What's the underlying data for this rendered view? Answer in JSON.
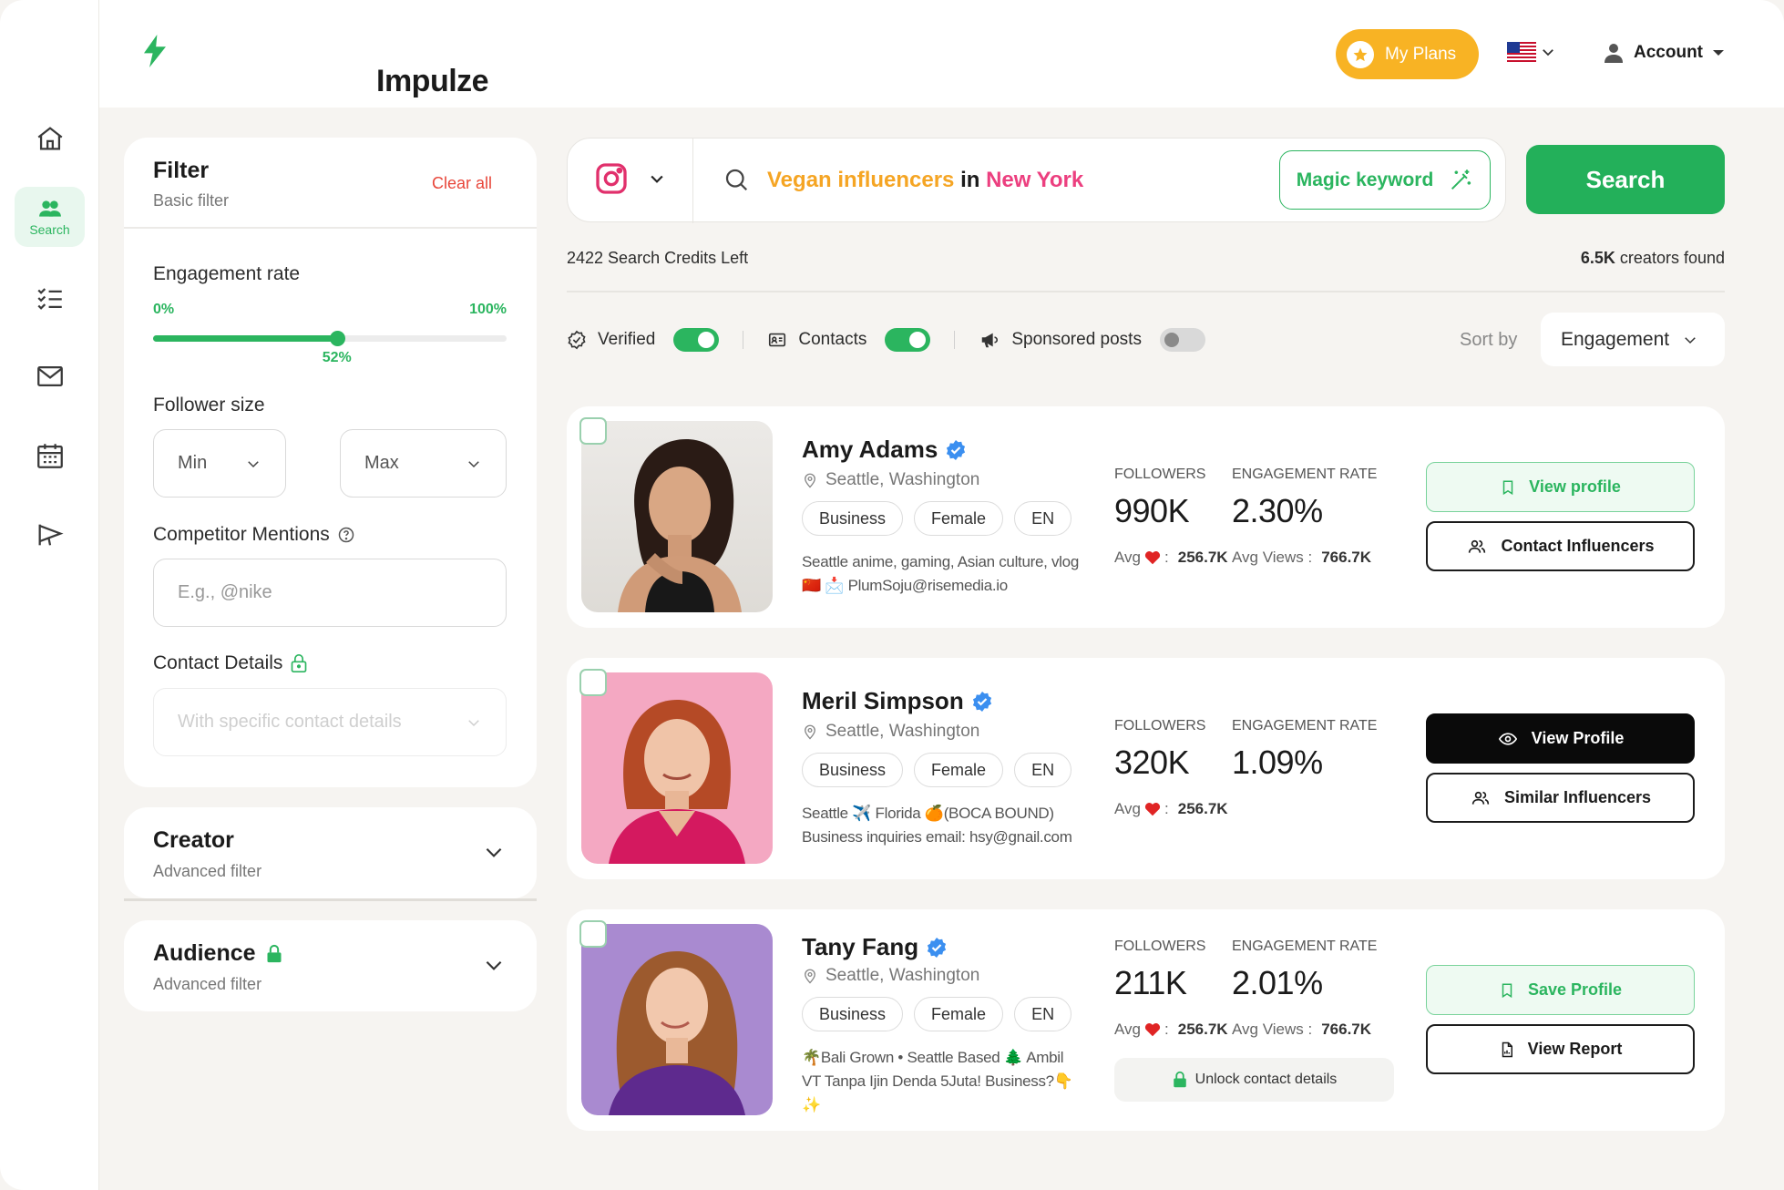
{
  "app": {
    "name": "Impulze"
  },
  "header": {
    "plans_label": "My Plans",
    "account_label": "Account"
  },
  "sidebar": {
    "items": [
      {
        "id": "home",
        "label": ""
      },
      {
        "id": "search",
        "label": "Search"
      },
      {
        "id": "lists",
        "label": ""
      },
      {
        "id": "mail",
        "label": ""
      },
      {
        "id": "calendar",
        "label": ""
      },
      {
        "id": "campaigns",
        "label": ""
      }
    ]
  },
  "filter": {
    "title": "Filter",
    "subtitle": "Basic filter",
    "clear_all": "Clear all",
    "engagement": {
      "label": "Engagement rate",
      "min_label": "0%",
      "max_label": "100%",
      "value": 52,
      "value_label": "52%"
    },
    "follower_size": {
      "label": "Follower size",
      "min": "Min",
      "max": "Max"
    },
    "competitor": {
      "label": "Competitor Mentions",
      "placeholder": "E.g., @nike"
    },
    "contact": {
      "label": "Contact Details",
      "placeholder": "With specific contact details"
    }
  },
  "accordions": [
    {
      "title": "Creator",
      "subtitle": "Advanced filter"
    },
    {
      "title": "Audience",
      "subtitle": "Advanced filter"
    }
  ],
  "search": {
    "query_part1": "Vegan influencers",
    "query_part2": " in ",
    "query_part3": "New York",
    "magic_label": "Magic keyword",
    "button_label": "Search",
    "credits": "2422 Search Credits Left",
    "found_count": "6.5K",
    "found_suffix": " creators found"
  },
  "toggles": {
    "verified": "Verified",
    "contacts": "Contacts",
    "sponsored": "Sponsored posts",
    "sort_label": "Sort by",
    "sort_value": "Engagement"
  },
  "influencers": [
    {
      "name": "Amy Adams",
      "location": "Seattle, Washington",
      "tags": [
        "Business",
        "Female",
        "EN"
      ],
      "bio": "Seattle anime, gaming, Asian culture, vlog🇨🇳 📩 PlumSoju@risemedia.io",
      "followers_label": "FOLLOWERS",
      "followers": "990K",
      "er_label": "ENGAGEMENT RATE",
      "er": "2.30%",
      "avg_label": "Avg",
      "avg_likes": "256.7K",
      "avg_views_label": "Avg Views :",
      "avg_views": "766.7K",
      "btn1": "View profile",
      "btn2": "Contact Influencers"
    },
    {
      "name": "Meril Simpson",
      "location": "Seattle, Washington",
      "tags": [
        "Business",
        "Female",
        "EN"
      ],
      "bio": "Seattle ✈️ Florida 🍊(BOCA BOUND) Business inquiries email: hsy@gnail.com",
      "followers_label": "FOLLOWERS",
      "followers": "320K",
      "er_label": "ENGAGEMENT RATE",
      "er": "1.09%",
      "avg_label": "Avg",
      "avg_likes": "256.7K",
      "btn1": "View Profile",
      "btn2": "Similar Influencers"
    },
    {
      "name": "Tany Fang",
      "location": "Seattle, Washington",
      "tags": [
        "Business",
        "Female",
        "EN"
      ],
      "bio": "🌴Bali Grown • Seattle Based 🌲 Ambil VT Tanpa Ijin Denda 5Juta! Business?👇 ✨",
      "followers_label": "FOLLOWERS",
      "followers": "211K",
      "er_label": "ENGAGEMENT RATE",
      "er": "2.01%",
      "avg_label": "Avg",
      "avg_likes": "256.7K",
      "avg_views_label": "Avg Views :",
      "avg_views": "766.7K",
      "unlock": "Unlock contact details",
      "btn1": "Save Profile",
      "btn2": "View Report"
    }
  ]
}
